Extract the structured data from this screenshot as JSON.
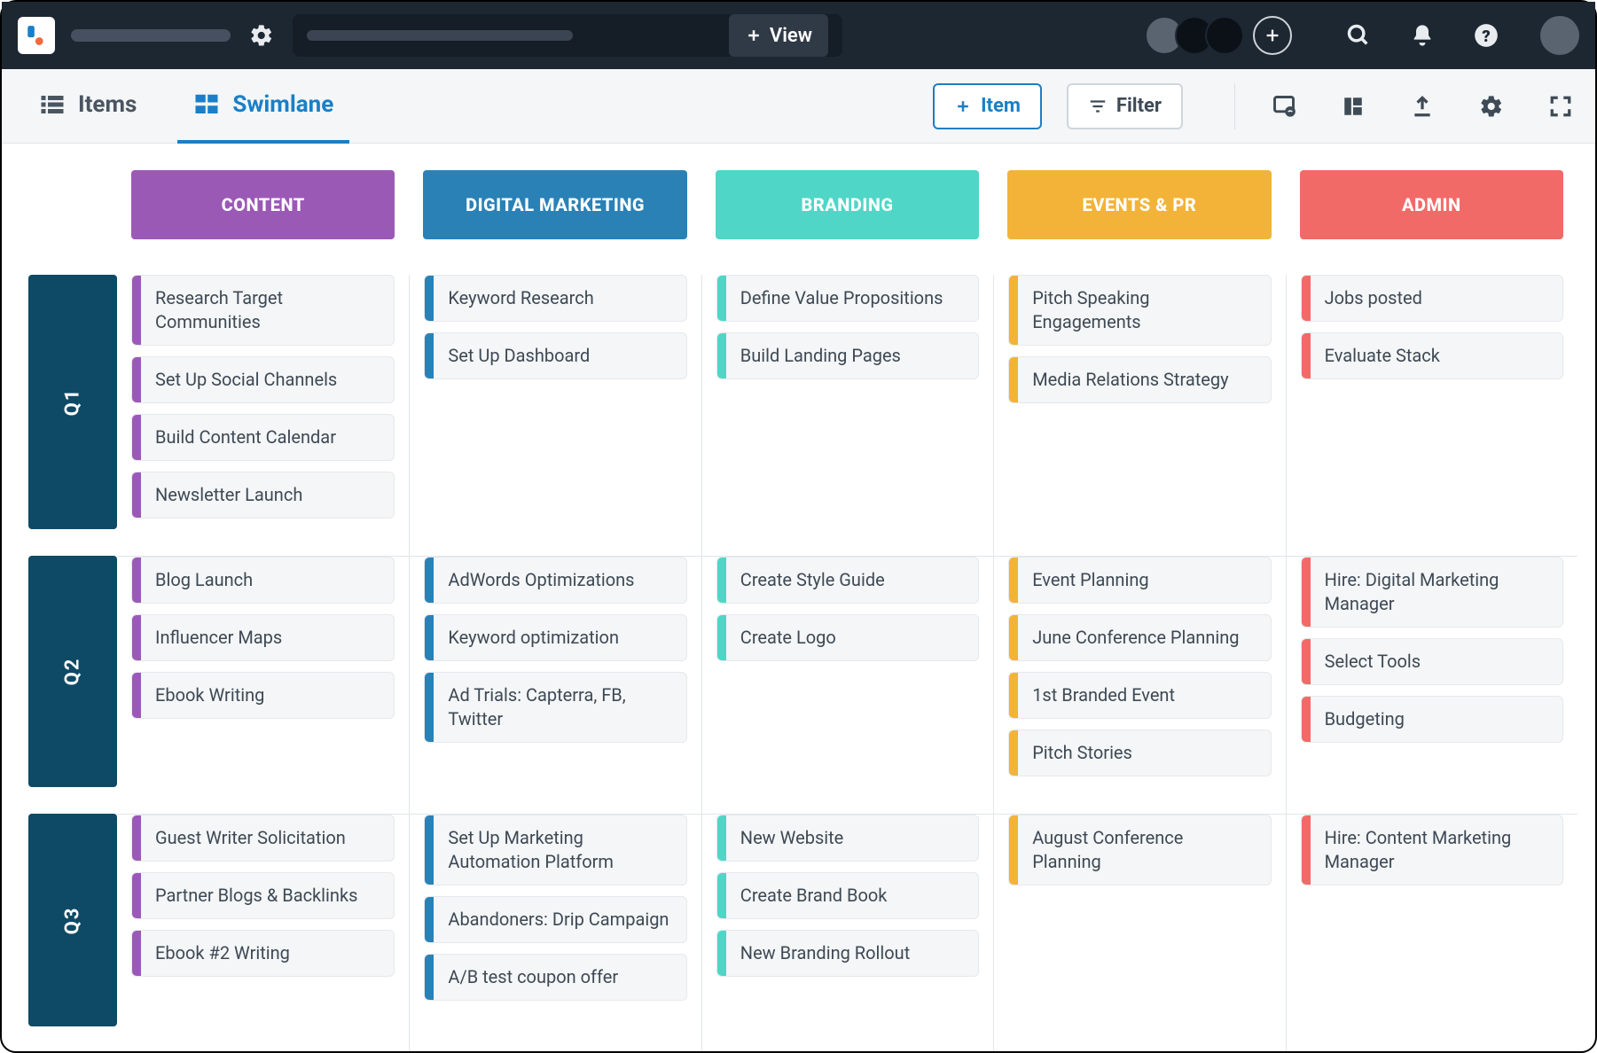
{
  "topbar": {
    "view_label": "View"
  },
  "subnav": {
    "tabs": [
      {
        "id": "items",
        "label": "Items",
        "active": false
      },
      {
        "id": "swimlane",
        "label": "Swimlane",
        "active": true
      }
    ],
    "item_btn": "Item",
    "filter_btn": "Filter"
  },
  "columns": [
    {
      "id": "content",
      "label": "CONTENT",
      "color": "#9b59b6",
      "stripe": "#9b59b6"
    },
    {
      "id": "digital-marketing",
      "label": "DIGITAL MARKETING",
      "color": "#2a81b6",
      "stripe": "#2a81b6"
    },
    {
      "id": "branding",
      "label": "BRANDING",
      "color": "#4fd6c6",
      "stripe": "#4fd6c6"
    },
    {
      "id": "events-pr",
      "label": "EVENTS & PR",
      "color": "#f2b338",
      "stripe": "#f2b338"
    },
    {
      "id": "admin",
      "label": "ADMIN",
      "color": "#f26a68",
      "stripe": "#f26a68"
    }
  ],
  "rows": [
    {
      "id": "q1",
      "label": "Q1",
      "cells": [
        [
          "Research Target Communities",
          "Set Up Social Channels",
          "Build Content Calendar",
          "Newsletter Launch"
        ],
        [
          "Keyword Research",
          "Set Up Dashboard"
        ],
        [
          "Define Value Propositions",
          "Build Landing Pages"
        ],
        [
          "Pitch Speaking Engagements",
          "Media Relations Strategy"
        ],
        [
          "Jobs posted",
          "Evaluate Stack"
        ]
      ]
    },
    {
      "id": "q2",
      "label": "Q2",
      "cells": [
        [
          "Blog Launch",
          "Influencer Maps",
          "Ebook Writing"
        ],
        [
          "AdWords Optimizations",
          "Keyword optimization",
          "Ad Trials: Capterra, FB, Twitter"
        ],
        [
          "Create Style Guide",
          "Create Logo"
        ],
        [
          "Event Planning",
          "June Conference Planning",
          "1st Branded Event",
          "Pitch Stories"
        ],
        [
          "Hire: Digital Marketing Manager",
          "Select Tools",
          "Budgeting"
        ]
      ]
    },
    {
      "id": "q3",
      "label": "Q3",
      "cells": [
        [
          "Guest Writer Solicitation",
          "Partner Blogs & Backlinks",
          "Ebook #2 Writing"
        ],
        [
          "Set Up Marketing Automation Platform",
          "Abandoners: Drip Campaign",
          "A/B test coupon offer"
        ],
        [
          "New Website",
          "Create Brand Book",
          "New Branding Rollout"
        ],
        [
          "August Conference Planning"
        ],
        [
          "Hire: Content Marketing Manager"
        ]
      ]
    }
  ]
}
